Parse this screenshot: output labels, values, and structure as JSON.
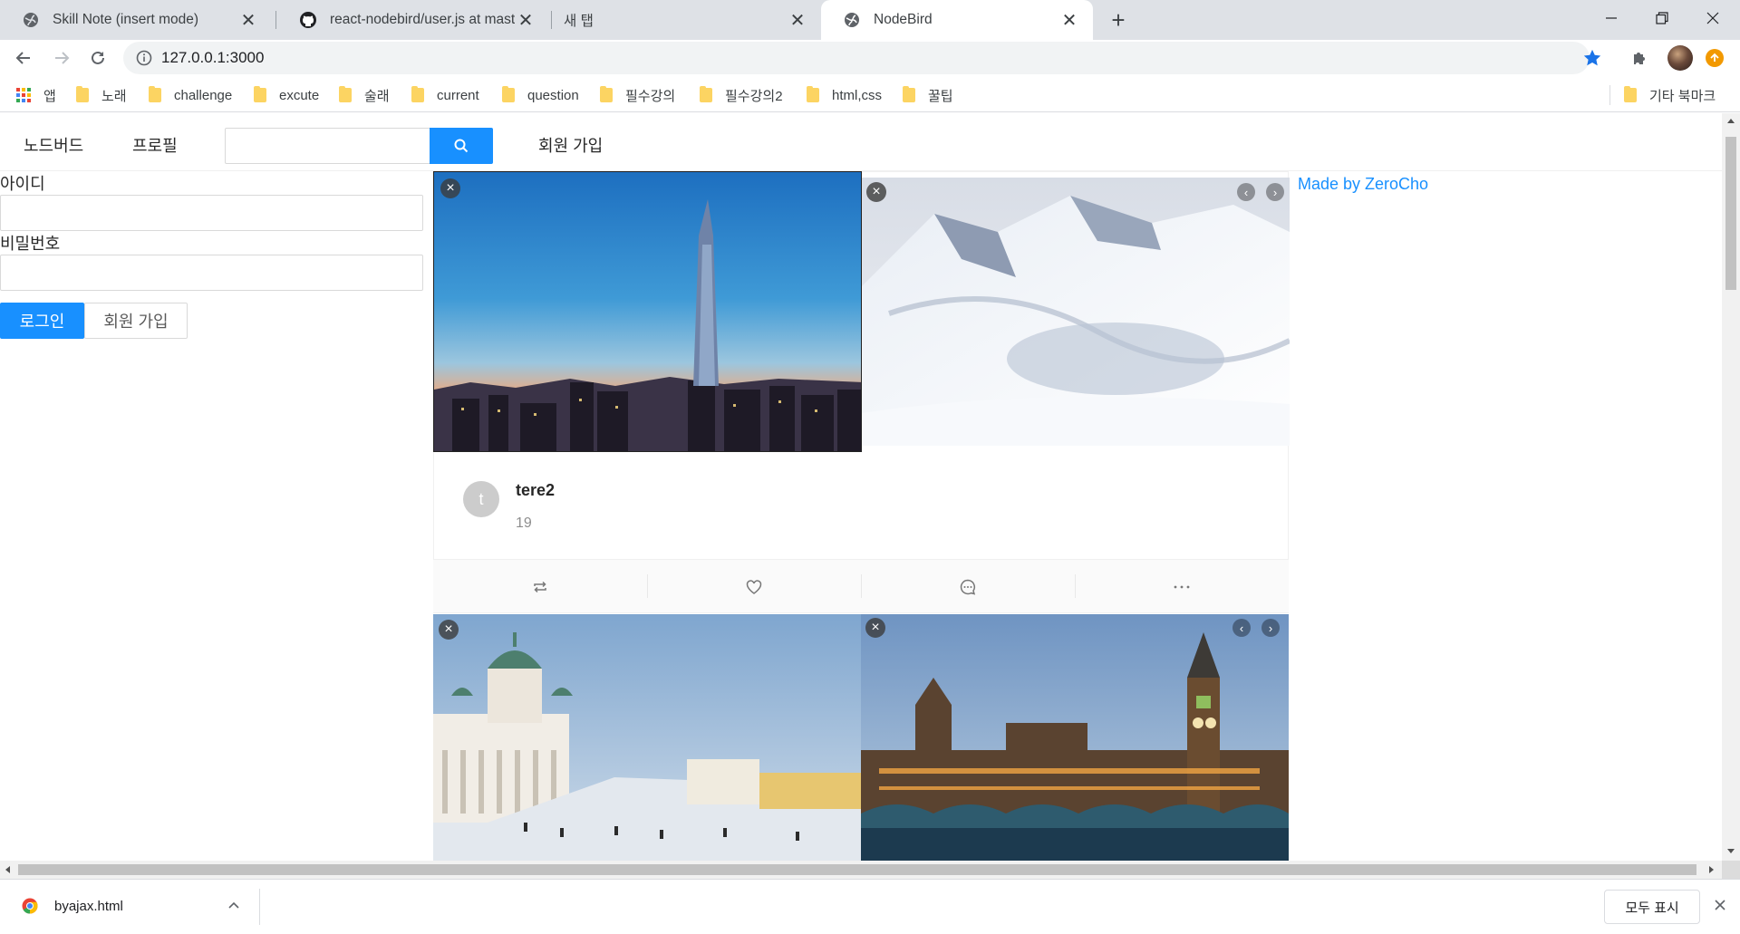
{
  "tabs": [
    {
      "title": "Skill Note (insert mode)",
      "icon": "globe-icon"
    },
    {
      "title": "react-nodebird/user.js at master",
      "icon": "github-icon"
    },
    {
      "title": "새 탭",
      "icon": "none"
    },
    {
      "title": "NodeBird",
      "icon": "globe-icon",
      "active": true
    }
  ],
  "address": {
    "url": "127.0.0.1:3000"
  },
  "bookmarks": {
    "apps": "앱",
    "items": [
      "노래",
      "challenge",
      "excute",
      "술래",
      "current",
      "question",
      "필수강의",
      "필수강의2",
      "html,css",
      "꿀팁"
    ],
    "other": "기타 북마크"
  },
  "menu": {
    "home": "노드버드",
    "profile": "프로필",
    "search_placeholder": "",
    "signup": "회원 가입"
  },
  "login": {
    "id_label": "아이디",
    "id_value": "",
    "pw_label": "비밀번호",
    "pw_value": "",
    "login_button": "로그인",
    "signup_button": "회원 가입"
  },
  "credit": "Made by ZeroCho",
  "posts": [
    {
      "author": "tere2",
      "avatar_letter": "t",
      "content": "19",
      "images": [
        "seoul-lotte-tower",
        "snow-mountain"
      ]
    },
    {
      "author": "",
      "avatar_letter": "",
      "content": "",
      "images": [
        "helsinki-cathedral",
        "london-parliament"
      ]
    }
  ],
  "download": {
    "filename": "byajax.html",
    "show_all": "모두 표시"
  },
  "colors": {
    "primary": "#1890ff",
    "chrome_bg": "#dee1e6",
    "link": "#1890ff"
  }
}
